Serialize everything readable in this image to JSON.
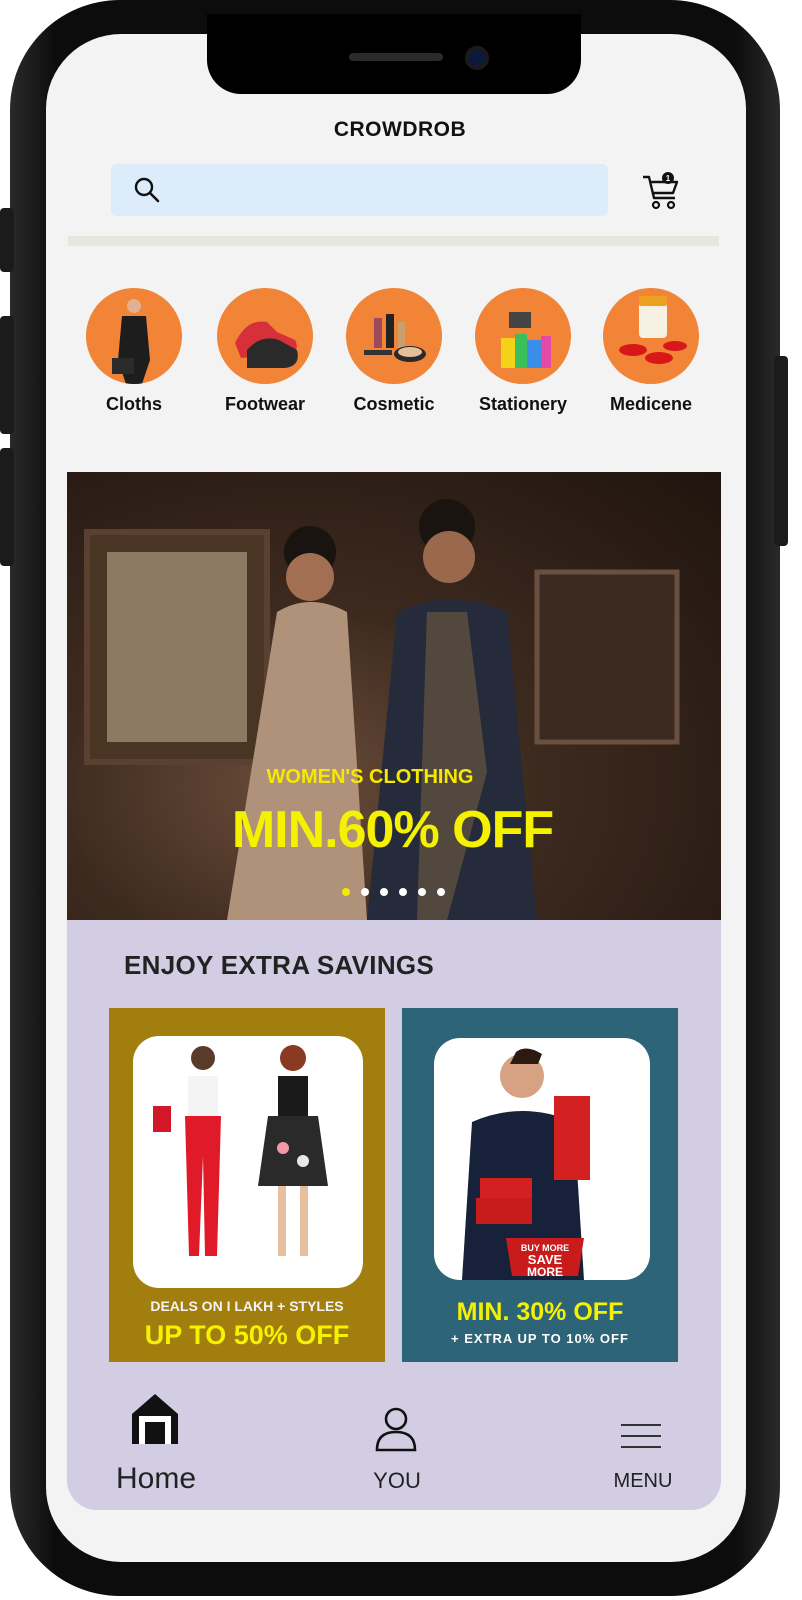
{
  "header": {
    "logo_text": "CROWDROB",
    "search_placeholder": "",
    "cart_count": "1"
  },
  "categories": [
    {
      "label": "Cloths",
      "icon": "cloths-icon"
    },
    {
      "label": "Footwear",
      "icon": "footwear-icon"
    },
    {
      "label": "Cosmetic",
      "icon": "cosmetic-icon"
    },
    {
      "label": "Stationery",
      "icon": "stationery-icon"
    },
    {
      "label": "Medicene",
      "icon": "medicine-icon"
    }
  ],
  "banner": {
    "subtitle": "WOMEN'S CLOTHING",
    "headline": "MIN.60% OFF",
    "slide_count": 6,
    "active_slide": 1
  },
  "savings": {
    "title": "ENJOY EXTRA SAVINGS",
    "cards": [
      {
        "line1": "DEALS ON I LAKH + STYLES",
        "line2": "UP TO 50% OFF",
        "bg": "#a27e0f"
      },
      {
        "line1": "MIN. 30% OFF",
        "line2": "+ EXTRA UP TO 10% OFF",
        "badge_top": "BUY MORE",
        "badge_mid": "SAVE",
        "badge_bot": "MORE",
        "bg": "#2d6477"
      }
    ]
  },
  "nav": {
    "home": "Home",
    "you": "YOU",
    "menu": "MENU"
  },
  "colors": {
    "accent_orange": "#f28437",
    "search_bg": "#dcecfb",
    "banner_text": "#f5f200",
    "savings_bg": "#d2cde3"
  }
}
